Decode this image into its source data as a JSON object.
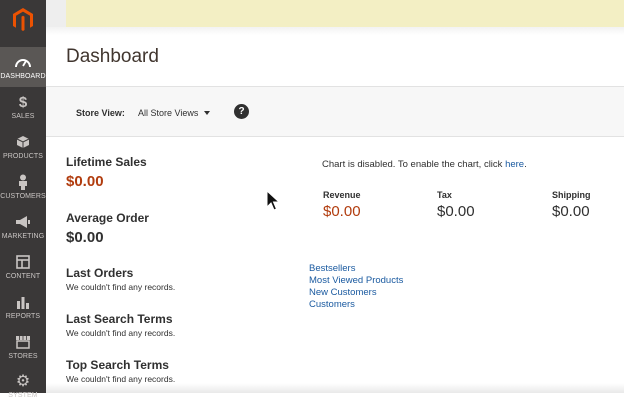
{
  "brand": {
    "logo_color": "#eb5202"
  },
  "sidebar": {
    "items": [
      {
        "label": "DASHBOARD",
        "icon": "dashboard-icon",
        "active": true
      },
      {
        "label": "SALES",
        "icon": "dollar-icon"
      },
      {
        "label": "PRODUCTS",
        "icon": "box-icon"
      },
      {
        "label": "CUSTOMERS",
        "icon": "person-icon"
      },
      {
        "label": "MARKETING",
        "icon": "megaphone-icon"
      },
      {
        "label": "CONTENT",
        "icon": "layout-icon"
      },
      {
        "label": "REPORTS",
        "icon": "bar-chart-icon"
      },
      {
        "label": "STORES",
        "icon": "store-icon"
      },
      {
        "label": "SYSTEM",
        "icon": "gear-icon"
      }
    ]
  },
  "page": {
    "title": "Dashboard"
  },
  "store_view": {
    "label": "Store View:",
    "value": "All Store Views"
  },
  "stats": {
    "lifetime_sales": {
      "label": "Lifetime Sales",
      "value": "$0.00"
    },
    "average_order": {
      "label": "Average Order",
      "value": "$0.00"
    },
    "last_orders": {
      "label": "Last Orders",
      "empty": "We couldn't find any records."
    },
    "last_search_terms": {
      "label": "Last Search Terms",
      "empty": "We couldn't find any records."
    },
    "top_search_terms": {
      "label": "Top Search Terms",
      "empty": "We couldn't find any records."
    }
  },
  "chart_notice": {
    "text": "Chart is disabled. To enable the chart, click ",
    "link": "here",
    "suffix": "."
  },
  "totals": {
    "revenue": {
      "label": "Revenue",
      "value": "$0.00"
    },
    "tax": {
      "label": "Tax",
      "value": "$0.00"
    },
    "shipping": {
      "label": "Shipping",
      "value": "$0.00"
    }
  },
  "tabs": [
    "Bestsellers",
    "Most Viewed Products",
    "New Customers",
    "Customers"
  ],
  "colors": {
    "accent_orange": "#b13c0e",
    "link_blue": "#1a5aa0",
    "sidebar_bg": "#3a3838"
  }
}
